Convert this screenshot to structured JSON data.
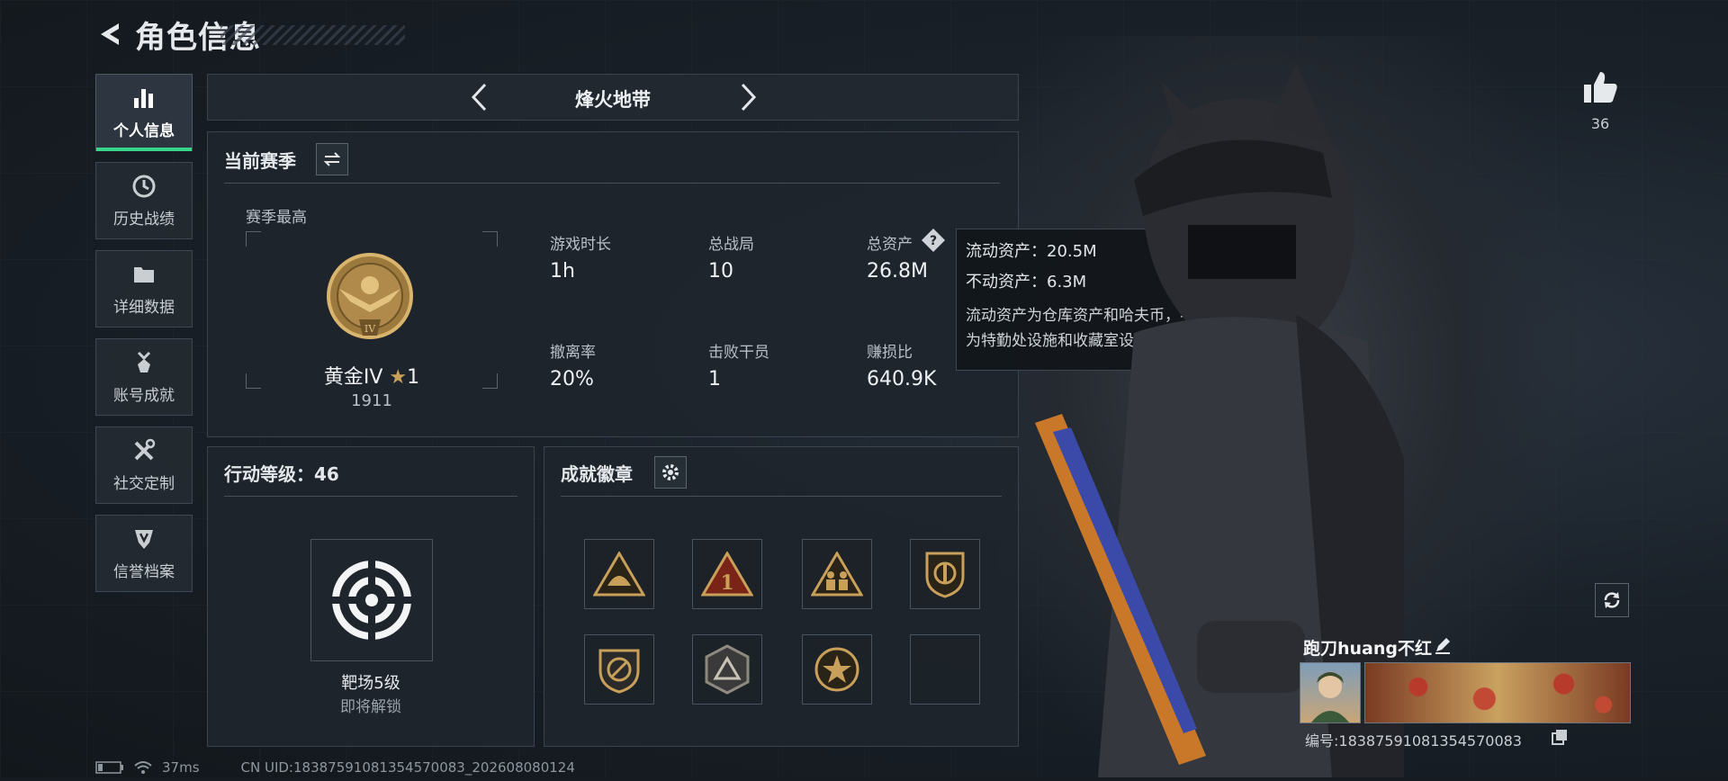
{
  "header": {
    "title": "角色信息"
  },
  "sidebar": {
    "items": [
      {
        "label": "个人信息",
        "icon": "bar-chart-icon",
        "active": true
      },
      {
        "label": "历史战绩",
        "icon": "clock-icon",
        "active": false
      },
      {
        "label": "详细数据",
        "icon": "folder-icon",
        "active": false
      },
      {
        "label": "账号成就",
        "icon": "medal-icon",
        "active": false
      },
      {
        "label": "社交定制",
        "icon": "tools-icon",
        "active": false
      },
      {
        "label": "信誉档案",
        "icon": "shield-icon",
        "active": false
      }
    ]
  },
  "mode_selector": {
    "label": "烽火地带"
  },
  "season": {
    "title": "当前赛季",
    "best_label": "赛季最高",
    "rank_name": "黄金IV",
    "rank_stars": "1",
    "rank_score": "1911",
    "rank_emblem_numeral": "IV",
    "stats": [
      {
        "label": "游戏时长",
        "value": "1h"
      },
      {
        "label": "总战局",
        "value": "10"
      },
      {
        "label": "总资产",
        "value": "26.8M"
      },
      {
        "label": "撤离率",
        "value": "20%"
      },
      {
        "label": "击败干员",
        "value": "1"
      },
      {
        "label": "赚损比",
        "value": "640.9K"
      }
    ]
  },
  "tooltip": {
    "line1": "流动资产：20.5M",
    "line2": "不动资产：6.3M",
    "desc1": "流动资产为仓库资产和哈夫币，不动资产",
    "desc2": "为特勤处设施和收藏室设施"
  },
  "action_level": {
    "title": "行动等级：46",
    "unlock_name": "靶场5级",
    "unlock_status": "即将解锁"
  },
  "achievements": {
    "title": "成就徽章",
    "badges": [
      "helmet-badge-icon",
      "number-one-badge-icon",
      "soldiers-badge-icon",
      "shield-badge-icon",
      "no-weapon-badge-icon",
      "triangle-badge-icon",
      "star-badge-icon",
      "empty-badge-slot"
    ]
  },
  "likes": {
    "count": "36"
  },
  "profile": {
    "name": "跑刀huang不红",
    "id_text": "编号:18387591081354570083"
  },
  "status": {
    "ping": "37ms",
    "uid": "CN UID:18387591081354570083_202608080124"
  },
  "colors": {
    "accent": "#38d68b",
    "gold": "#c8a05a"
  }
}
